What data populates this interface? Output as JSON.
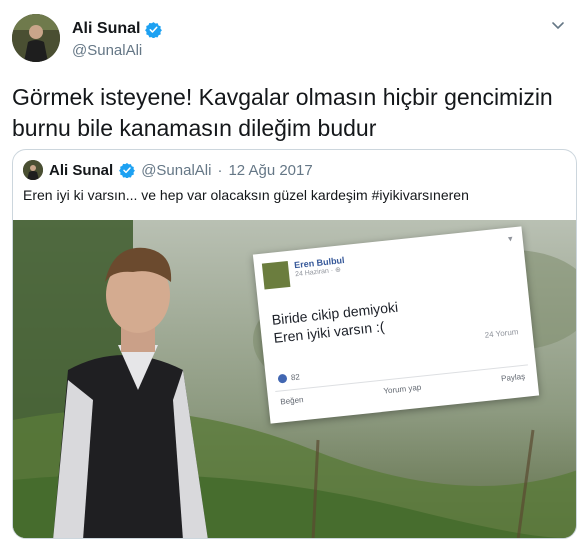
{
  "author": {
    "display_name": "Ali Sunal",
    "handle": "@SunalAli"
  },
  "tweet": {
    "text_line1": "Görmek isteyene! Kavgalar olmasın hiçbir gencimizin",
    "text_line2": "burnu bile kanamasın dileğim budur"
  },
  "quoted": {
    "display_name": "Ali Sunal",
    "handle": "@SunalAli",
    "separator": "·",
    "date": "12 Ağu 2017",
    "text": "Eren iyi ki varsın... ve hep var olacaksın güzel kardeşim #iyikivarsıneren"
  },
  "fb_post": {
    "name": "Eren Bulbul",
    "date": "24 Haziran · ⊕",
    "line1": "Biride cikip demiyoki",
    "line2": "Eren iyiki varsın :(",
    "timestamp": "24 Yorum",
    "reactions": "82",
    "like": "Beğen",
    "comment": "Yorum yap",
    "share": "Paylaş",
    "menu": "▾"
  },
  "colors": {
    "text": "#14171a",
    "secondary": "#657786",
    "verified": "#1da1f2",
    "border": "#ccd6dd"
  }
}
